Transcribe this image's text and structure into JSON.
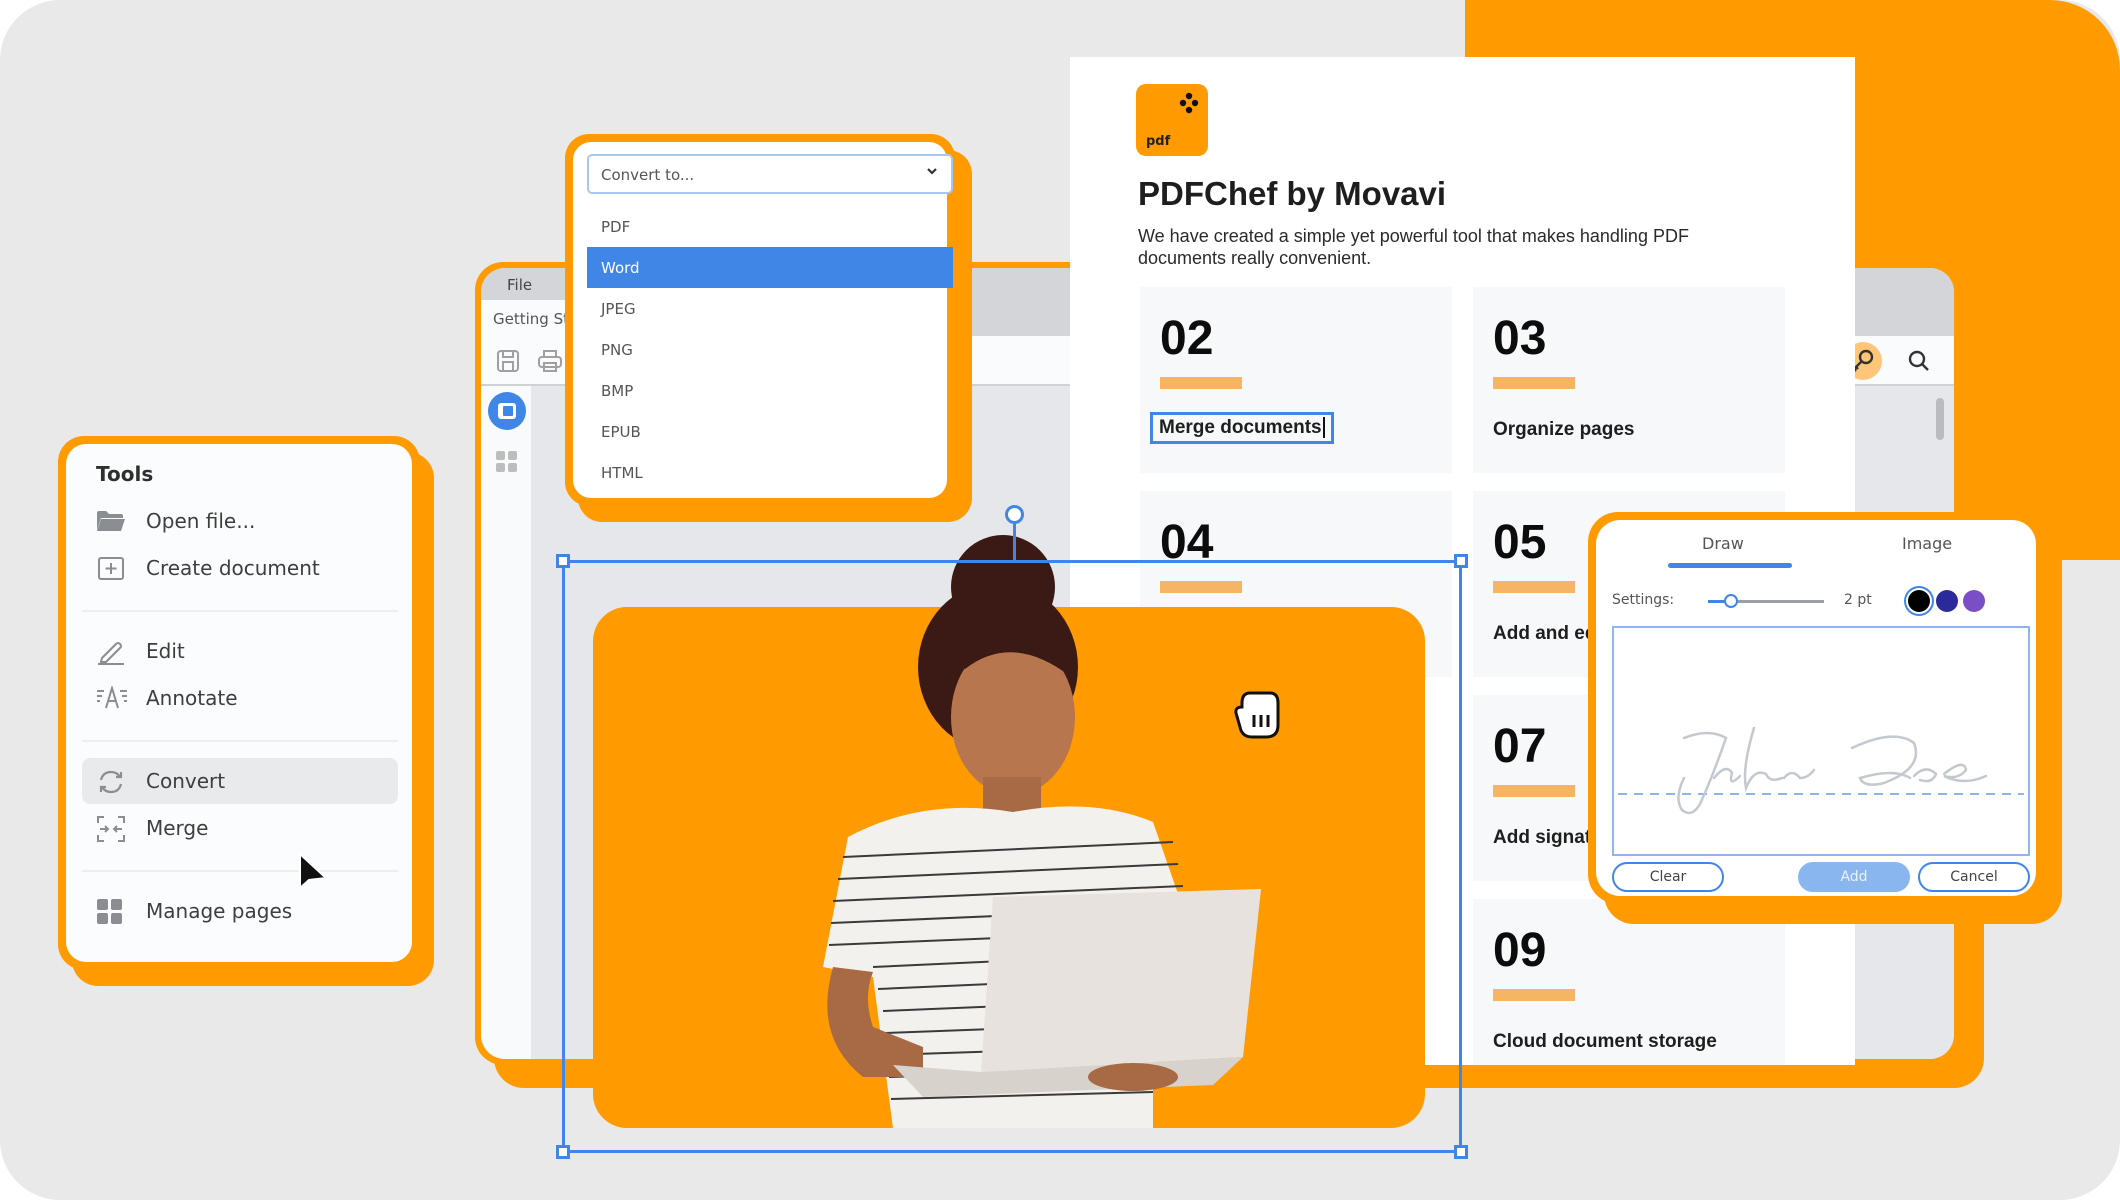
{
  "colors": {
    "brand_orange": "#ff9b00",
    "accent_blue": "#3f86e6",
    "card_bar": "#f5b565",
    "background": "#e9e9ea"
  },
  "app_window": {
    "menu": "File",
    "tab": "Getting Started",
    "toolbar_icons": [
      "save-icon",
      "print-icon",
      "key-icon",
      "search-icon"
    ],
    "side_icons": [
      "panel-icon",
      "grid-icon"
    ]
  },
  "tools_panel": {
    "title": "Tools",
    "groups": [
      [
        {
          "icon": "folder-icon",
          "label": "Open file..."
        },
        {
          "icon": "create-document-icon",
          "label": "Create document"
        }
      ],
      [
        {
          "icon": "pencil-icon",
          "label": "Edit"
        },
        {
          "icon": "annotate-icon",
          "label": "Annotate"
        }
      ],
      [
        {
          "icon": "convert-icon",
          "label": "Convert",
          "active": true
        },
        {
          "icon": "merge-icon",
          "label": "Merge"
        }
      ],
      [
        {
          "icon": "grid-icon",
          "label": "Manage pages"
        }
      ]
    ]
  },
  "convert_dropdown": {
    "placeholder": "Convert to...",
    "options": [
      "PDF",
      "Word",
      "JPEG",
      "PNG",
      "BMP",
      "EPUB",
      "HTML"
    ],
    "selected": "Word"
  },
  "document": {
    "logo_text": "pdf",
    "title": "PDFChef by Movavi",
    "subtitle": "We have created a simple yet powerful tool that makes handling PDF documents really convenient.",
    "cards": [
      {
        "num": "02",
        "label": "Merge documents",
        "editing": true
      },
      {
        "num": "03",
        "label": "Organize pages"
      },
      {
        "num": "04",
        "label": ""
      },
      {
        "num": "05",
        "label": "Add and ed"
      },
      {
        "num": "07",
        "label": "Add signatu"
      },
      {
        "num": "09",
        "label": "Cloud document storage"
      }
    ]
  },
  "signature_dialog": {
    "tabs": [
      "Draw",
      "Image"
    ],
    "active_tab": "Draw",
    "settings_label": "Settings:",
    "thickness": "2 pt",
    "thickness_fraction": 0.2,
    "colors": [
      "#000000",
      "#2b2a9c",
      "#7a4fc6"
    ],
    "selected_color": "#000000",
    "signature_text": "John Doe",
    "buttons": {
      "clear": "Clear",
      "add": "Add",
      "cancel": "Cancel"
    }
  }
}
